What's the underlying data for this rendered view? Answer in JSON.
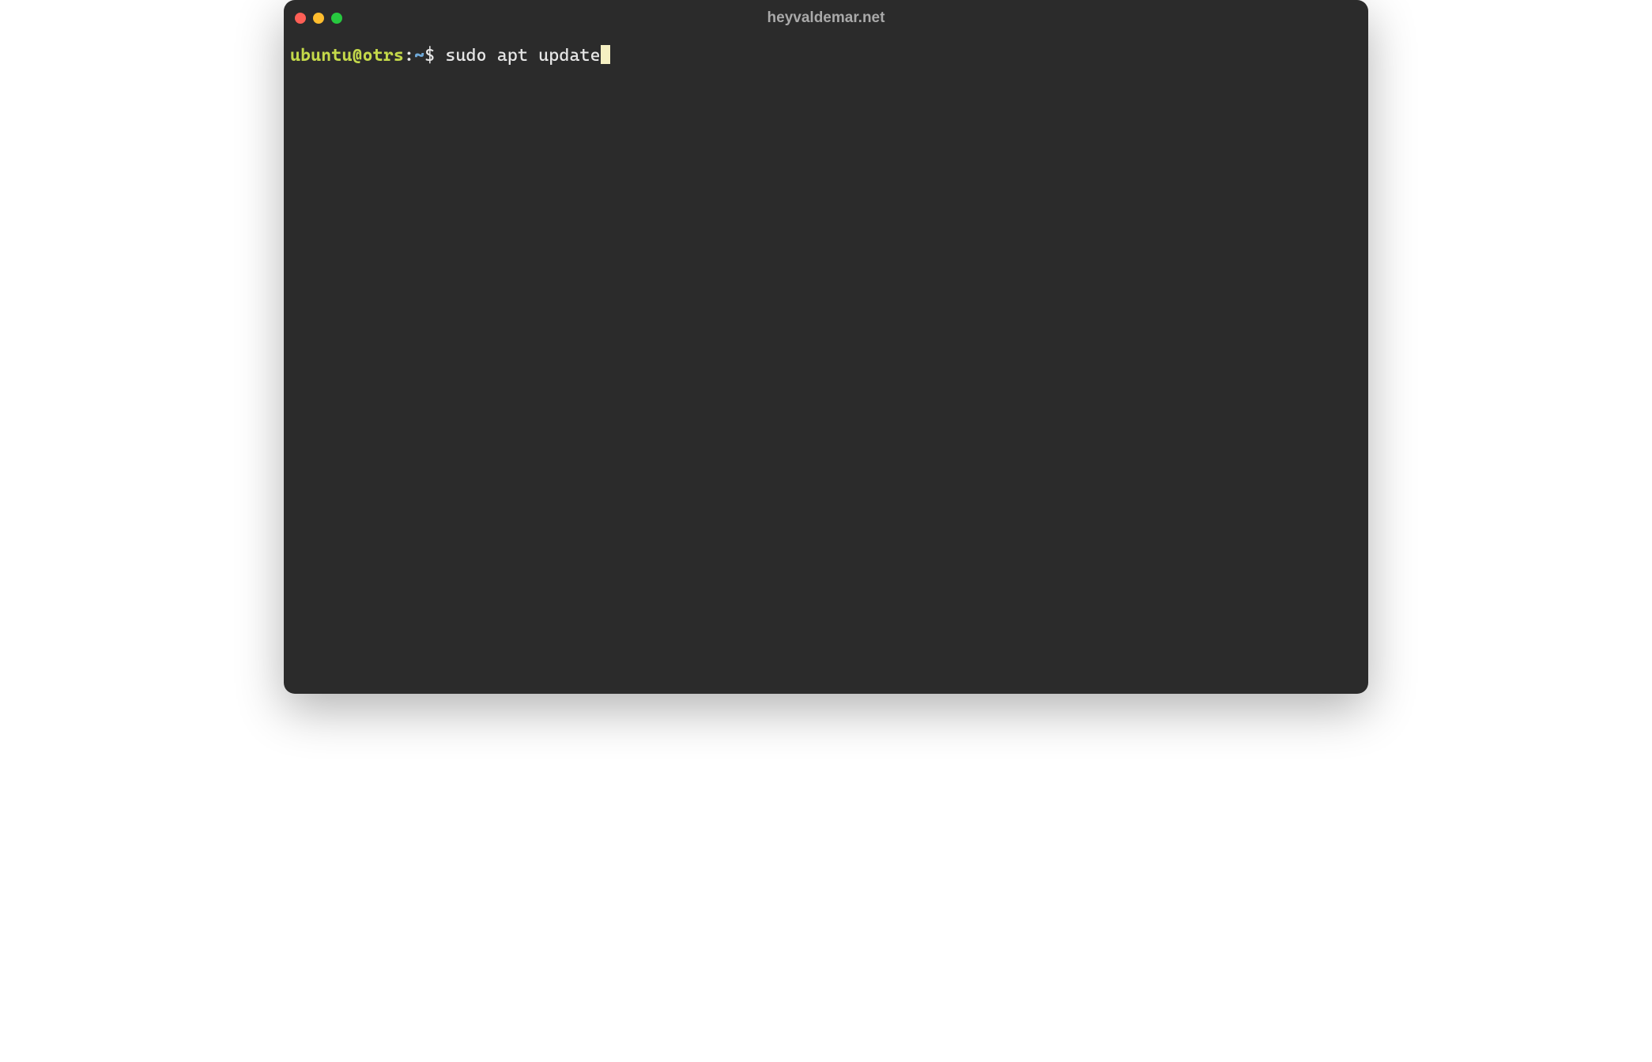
{
  "window": {
    "title": "heyvaldemar.net"
  },
  "terminal": {
    "prompt": {
      "user_host": "ubuntu@otrs",
      "separator": ":",
      "cwd": "~",
      "symbol": "$ "
    },
    "command": "sudo apt update"
  },
  "colors": {
    "bg": "#2b2b2b",
    "user_host": "#c4d94a",
    "cwd": "#6fa8d6",
    "text": "#e6e6e6",
    "cursor": "#f5f0c2",
    "close": "#ff5f56",
    "minimize": "#ffbd2e",
    "maximize": "#27c93f"
  }
}
